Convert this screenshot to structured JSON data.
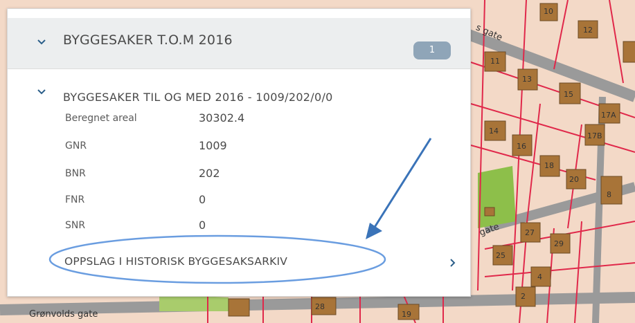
{
  "header": {
    "title": "BYGGESAKER T.O.M 2016",
    "badge": "1"
  },
  "record": {
    "title": "BYGGESAKER TIL OG MED 2016 - 1009/202/0/0",
    "fields": [
      {
        "label": "Beregnet areal",
        "value": "30302.4"
      },
      {
        "label": "GNR",
        "value": "1009"
      },
      {
        "label": "BNR",
        "value": "202"
      },
      {
        "label": "FNR",
        "value": "0"
      },
      {
        "label": "SNR",
        "value": "0"
      }
    ],
    "link_label": "OPPSLAG I HISTORISK BYGGESAKSARKIV"
  },
  "map": {
    "streets": [
      "s gate",
      "Grønvolds gate",
      "gate"
    ],
    "plot_labels": [
      "10",
      "12",
      "11",
      "13",
      "15",
      "17A",
      "14",
      "16",
      "17B",
      "18",
      "20",
      "8",
      "27",
      "29",
      "25",
      "4",
      "2",
      "28",
      "19"
    ]
  },
  "colors": {
    "map_bg": "#f3d9c7",
    "parcel_line": "#e0284a",
    "building": "#a87438",
    "road": "#9a9a9a",
    "green": "#8dbf4a",
    "badge": "#8fa5b8",
    "annotation": "#3a73b8"
  }
}
